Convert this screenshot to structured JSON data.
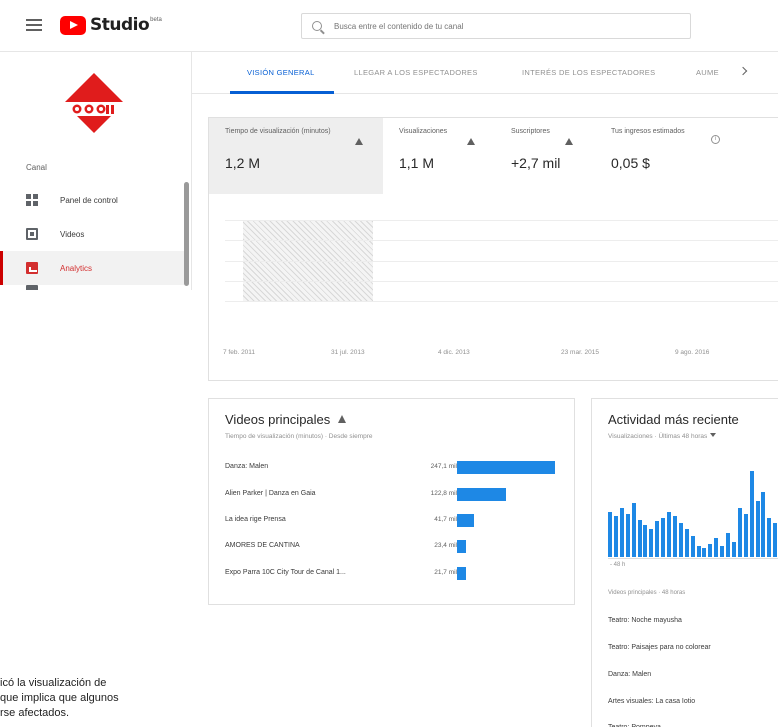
{
  "app": {
    "name": "Studio",
    "badge": "beta"
  },
  "search": {
    "placeholder": "Busca entre el contenido de tu canal"
  },
  "sidebar": {
    "section_label": "Canal",
    "items": [
      {
        "label": "Panel de control",
        "icon": "dashboard-icon"
      },
      {
        "label": "Videos",
        "icon": "video-icon"
      },
      {
        "label": "Analytics",
        "icon": "analytics-icon",
        "active": true
      },
      {
        "label": "",
        "icon": "next-icon"
      }
    ]
  },
  "tabs": [
    {
      "label": "VISIÓN GENERAL",
      "active": true
    },
    {
      "label": "LLEGAR A LOS ESPECTADORES"
    },
    {
      "label": "INTERÉS DE LOS ESPECTADORES"
    },
    {
      "label": "AUME"
    }
  ],
  "overview": {
    "metrics": [
      {
        "label": "Tiempo de visualización (minutos)",
        "value": "1,2 M",
        "selected": true,
        "indicator": "warning"
      },
      {
        "label": "Visualizaciones",
        "value": "1,1 M",
        "indicator": "warning"
      },
      {
        "label": "Suscriptores",
        "value": "+2,7 mil",
        "indicator": "warning"
      },
      {
        "label": "Tus ingresos estimados",
        "value": "0,05 $",
        "indicator": "info"
      }
    ],
    "info_symbol": "i",
    "x_labels": [
      "7 feb. 2011",
      "31 jul. 2013",
      "4 dic. 2013",
      "23 mar. 2015",
      "9 ago. 2016"
    ]
  },
  "top_videos": {
    "title": "Videos principales",
    "subtitle": "Tiempo de visualización (minutos) · Desde siempre",
    "rows": [
      {
        "title": "Danza: Malen",
        "value": "247,1 mil",
        "amount": 247.1
      },
      {
        "title": "Alien Parker | Danza en Gaia",
        "value": "122,8 mil",
        "amount": 122.8
      },
      {
        "title": "La idea rige Prensa",
        "value": "41,7 mil",
        "amount": 41.7
      },
      {
        "title": "AMORES DE CANTINA",
        "value": "23,4 mil",
        "amount": 23.4
      },
      {
        "title": "Expo Parra 10C City Tour de Canal 1...",
        "value": "21,7 mil",
        "amount": 21.7
      }
    ]
  },
  "recent": {
    "title": "Actividad más reciente",
    "subtitle": "Visualizaciones · Últimas 48 horas",
    "min_label": "- 48 h",
    "sub2": "Videos principales · 48 horas",
    "bars": [
      48,
      44,
      52,
      46,
      58,
      40,
      34,
      30,
      38,
      42,
      48,
      44,
      36,
      30,
      22,
      12,
      10,
      14,
      20,
      12,
      26,
      16,
      52,
      46,
      92,
      60,
      70,
      42,
      36
    ],
    "items": [
      "Teatro: Noche mayusha",
      "Teatro: Paisajes para no colorear",
      "Danza: Malen",
      "Artes visuales: La casa Iotio",
      "Teatro: Pompeya"
    ]
  },
  "tooltip_fragment": [
    "icó la visualización de",
    "que implica que algunos",
    "rse afectados."
  ],
  "colors": {
    "accent": "#065fd4",
    "brand": "#ff0000",
    "bar": "#1e88e5",
    "active_nav": "#cc0000"
  }
}
